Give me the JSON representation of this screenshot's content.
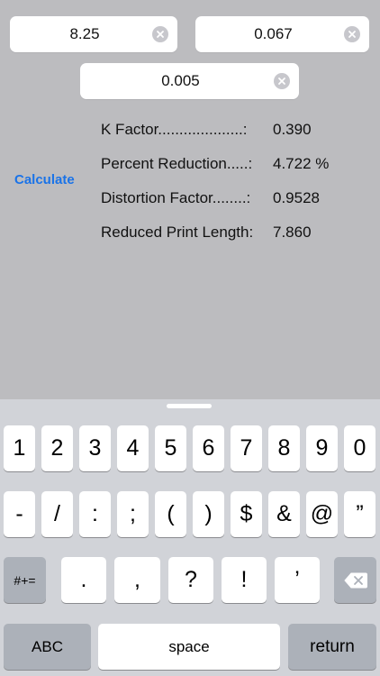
{
  "inputs": [
    {
      "value": "8.25"
    },
    {
      "value": "0.067"
    },
    {
      "value": "0.005"
    }
  ],
  "calculate_label": "Calculate",
  "results": [
    {
      "label": "K Factor....................:",
      "value": "0.390"
    },
    {
      "label": "Percent Reduction.....:",
      "value": "4.722 %"
    },
    {
      "label": "Distortion Factor........:",
      "value": "0.9528"
    },
    {
      "label": "Reduced Print Length:",
      "value": "7.860"
    }
  ],
  "keyboard": {
    "row1": [
      "1",
      "2",
      "3",
      "4",
      "5",
      "6",
      "7",
      "8",
      "9",
      "0"
    ],
    "row2": [
      "-",
      "/",
      ":",
      ";",
      "(",
      ")",
      "$",
      "&",
      "@",
      "”"
    ],
    "row3_mode": "#+=",
    "row3": [
      ".",
      ",",
      "?",
      "!",
      "’"
    ],
    "row4": {
      "abc": "ABC",
      "space": "space",
      "return": "return"
    },
    "backspace_icon": "backspace-icon"
  },
  "colors": {
    "accent": "#1a73e8",
    "background": "#bcbcbf",
    "keyboard": "#d1d3d8"
  }
}
